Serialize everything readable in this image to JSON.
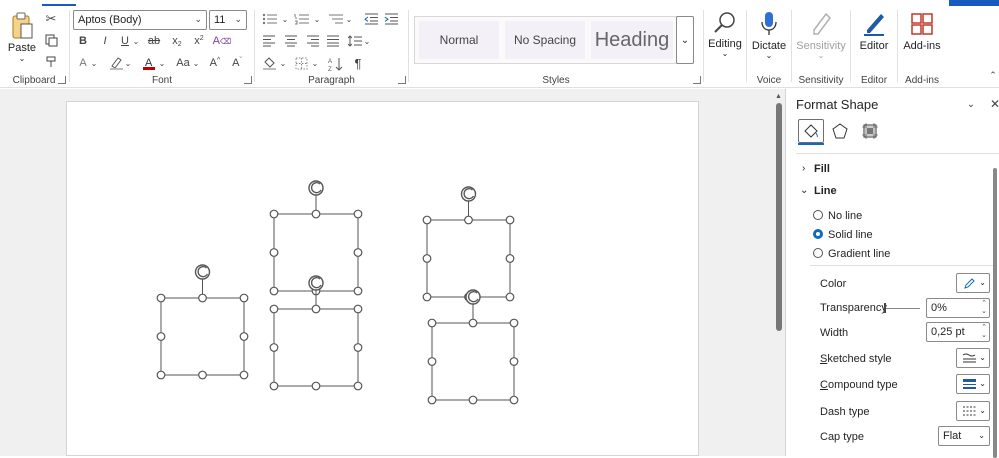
{
  "ribbon": {
    "clipboard": {
      "paste_label": "Paste",
      "group_label": "Clipboard"
    },
    "font": {
      "font_name": "Aptos (Body)",
      "font_size": "11",
      "group_label": "Font"
    },
    "paragraph": {
      "group_label": "Paragraph"
    },
    "styles": {
      "items": [
        "Normal",
        "No Spacing",
        "Heading"
      ],
      "group_label": "Styles"
    },
    "editing": {
      "label": "Editing"
    },
    "voice": {
      "dictate_label": "Dictate",
      "group_label": "Voice"
    },
    "sensitivity": {
      "label": "Sensitivity",
      "group_label": "Sensitivity"
    },
    "editor": {
      "label": "Editor",
      "group_label": "Editor"
    },
    "addins": {
      "label": "Add-ins",
      "group_label": "Add-ins"
    }
  },
  "pane": {
    "title": "Format Shape",
    "sections": {
      "fill": "Fill",
      "line": "Line"
    },
    "line_options": {
      "no_line": "No line",
      "solid_line": "Solid line",
      "gradient_line": "Gradient line"
    },
    "props": {
      "color": "Color",
      "transparency": "Transparency",
      "transparency_value": "0%",
      "width": "Width",
      "width_value": "0,25 pt",
      "sketched": "Sketched style",
      "compound": "Compound type",
      "dash": "Dash type",
      "cap": "Cap type",
      "cap_value": "Flat"
    }
  },
  "colors": {
    "accent": "#0f6cbd",
    "color_a": "#c00000",
    "page_bg": "#ffffff",
    "canvas_bg": "#f0f0f0"
  }
}
